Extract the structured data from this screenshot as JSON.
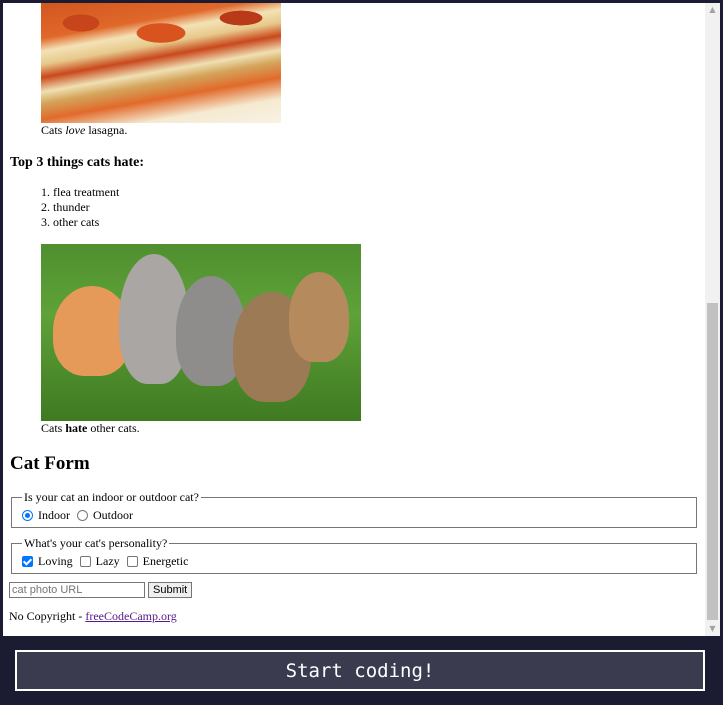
{
  "caption1": {
    "pre": "Cats ",
    "em": "love",
    "post": " lasagna."
  },
  "hate": {
    "title": "Top 3 things cats hate:",
    "items": [
      "flea treatment",
      "thunder",
      "other cats"
    ]
  },
  "caption2": {
    "pre": "Cats ",
    "strong": "hate",
    "post": " other cats."
  },
  "form": {
    "title": "Cat Form",
    "indoor_legend": "Is your cat an indoor or outdoor cat?",
    "indoor_label": "Indoor",
    "outdoor_label": "Outdoor",
    "personality_legend": "What's your cat's personality?",
    "loving_label": "Loving",
    "lazy_label": "Lazy",
    "energetic_label": "Energetic",
    "url_placeholder": "cat photo URL",
    "submit_label": "Submit"
  },
  "footer": {
    "text": "No Copyright - ",
    "link": "freeCodeCamp.org"
  },
  "start_button": "Start coding!",
  "colors": {
    "accent": "#0075ff",
    "dark_bg": "#1b1b32",
    "button_bg": "#3b3b4f"
  }
}
